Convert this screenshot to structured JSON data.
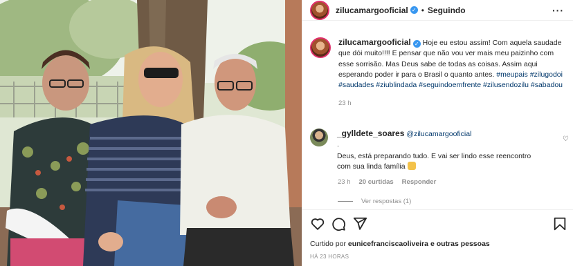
{
  "post": {
    "username": "zilucamargooficial",
    "verified_icon": "verified-badge-icon",
    "separator": "•",
    "follow_status": "Seguindo",
    "more_icon": "more-options-icon",
    "more_label": "···"
  },
  "caption": {
    "username": "zilucamargooficial",
    "text": "Hoje eu estou assim! Com aquela saudade que dói muito!!!! E pensar que não vou ver mais meu paizinho com esse sorrisão. Mas Deus sabe de todas as coisas. Assim aqui esperando poder ir para o Brasil o quanto antes.",
    "hashtags": "#meupais #zilugodoi #saudades #ziublindada #seguindoemfrente #zilusendozilu #sabadou",
    "time": "23 h"
  },
  "comment": {
    "username": "_gylldete_soares",
    "mention": "@zilucamargooficial",
    "line1": ".",
    "text": "Deus, está preparando tudo. E vai ser lindo esse reencontro com sua linda família",
    "emoji_icon": "raised-hands-emoji-icon",
    "time": "23 h",
    "likes": "20 curtidas",
    "reply_label": "Responder",
    "view_replies": "Ver respostas (1)"
  },
  "actions": {
    "like_icon": "heart-icon",
    "comment_icon": "comment-icon",
    "share_icon": "share-icon",
    "save_icon": "bookmark-icon"
  },
  "likes": {
    "prefix": "Curtido por",
    "user": "eunicefranciscaoliveira",
    "suffix": "e outras pessoas"
  },
  "timestamp": "HÁ 23 HORAS"
}
